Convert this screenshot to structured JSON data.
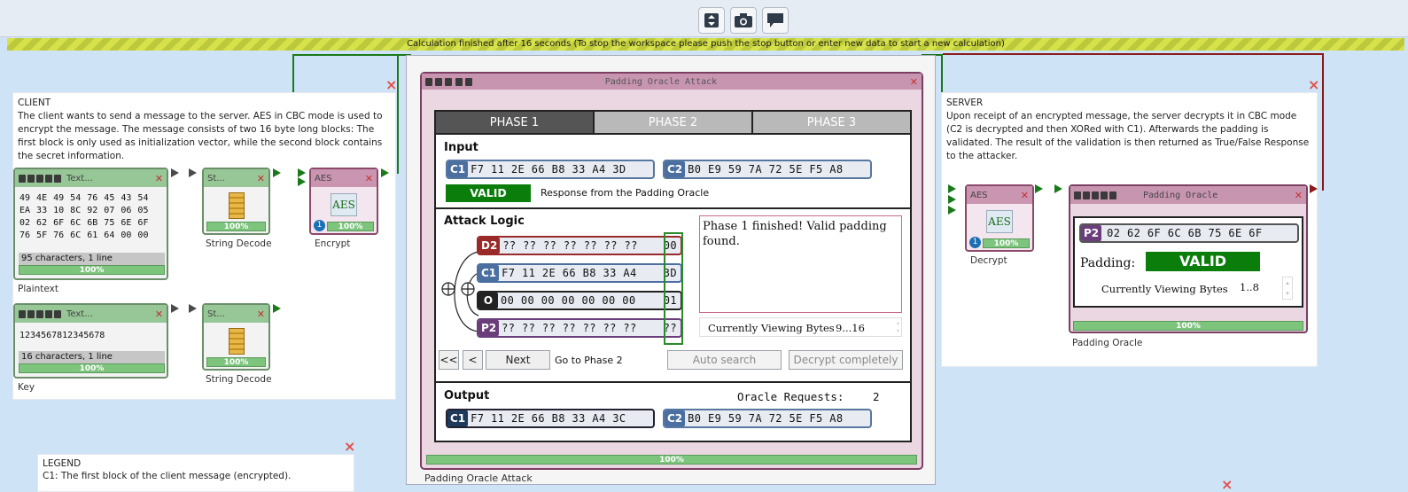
{
  "toolbar": {
    "buttons": [
      {
        "icon": "fit-page-icon"
      },
      {
        "icon": "camera-icon"
      },
      {
        "icon": "speech-bubble-icon"
      }
    ]
  },
  "status": "Calculation finished after 16 seconds (To stop the workspace please push the stop button or enter new data to start a new calculation)",
  "client": {
    "title": "CLIENT",
    "text": "The client wants to send a message to the server. AES in CBC mode is used to encrypt the message. The message consists of two 16 byte long blocks: The first block is only used as initialization vector, while the second block contains the secret information."
  },
  "server": {
    "title": "SERVER",
    "text": "Upon receipt of an encrypted message, the server decrypts it in CBC mode (C2 is decrypted and then XORed with C1). Afterwards the padding is validated. The result of the validation is then returned as True/False Response to the attacker."
  },
  "legend": {
    "title": "LEGEND",
    "line1": "C1: The first block of the client message (encrypted)."
  },
  "plaintext": {
    "header": "Text...",
    "content": "49 4E 49 54 76 45 43 54 EA 33 10 8C 92 07 06 05 02 62 6F 6C 6B 75 6E 6F 76 5F 76 6C 61 64 00 00",
    "info": "95 characters,  1 line",
    "progress": "100%",
    "label": "Plaintext"
  },
  "key": {
    "header": "Text...",
    "content": "1234567812345678",
    "info": "16 characters,  1 line",
    "progress": "100%",
    "label": "Key"
  },
  "decode1": {
    "header": "St...",
    "progress": "100%",
    "label": "String Decode"
  },
  "decode2": {
    "header": "St...",
    "progress": "100%",
    "label": "String Decode"
  },
  "encrypt": {
    "header": "AES",
    "icon_text": "AES",
    "badge": "1",
    "progress": "100%",
    "label": "Encrypt"
  },
  "decrypt": {
    "header": "AES",
    "icon_text": "AES",
    "badge": "1",
    "progress": "100%",
    "label": "Decrypt"
  },
  "poa": {
    "title": "Padding Oracle Attack",
    "tabs": [
      "PHASE 1",
      "PHASE 2",
      "PHASE 3"
    ],
    "input": {
      "heading": "Input",
      "c1_tag": "C1",
      "c1": "F7 11 2E 66 B8 33 A4 3D",
      "c2_tag": "C2",
      "c2": "B0 E9 59 7A 72 5E F5 A8",
      "valid": "VALID",
      "response": "Response from the Padding Oracle"
    },
    "logic": {
      "heading": "Attack Logic",
      "rows": [
        {
          "tag": "D2",
          "bytes": "?? ?? ?? ?? ?? ?? ??",
          "last": "00",
          "color": "#9a2a2a"
        },
        {
          "tag": "C1",
          "bytes": "F7 11 2E 66 B8 33 A4",
          "last": "3D",
          "color": "#4a6fa0"
        },
        {
          "tag": "O",
          "bytes": "00 00 00 00 00 00 00",
          "last": "01",
          "color": "#222222"
        },
        {
          "tag": "P2",
          "bytes": "?? ?? ?? ?? ?? ?? ??",
          "last": "??",
          "color": "#6a3e7a"
        }
      ],
      "message": "Phase 1 finished! Valid padding found.",
      "viewing_label": "Currently Viewing Bytes",
      "viewing_value": "9...16",
      "btn_first": "<<",
      "btn_prev": "<",
      "btn_next": "Next",
      "goto": "Go to Phase 2",
      "btn_auto": "Auto search",
      "btn_decrypt": "Decrypt completely"
    },
    "output": {
      "heading": "Output",
      "requests_label": "Oracle Requests:",
      "requests": "2",
      "c1_tag": "C1",
      "c1": "F7 11 2E 66 B8 33 A4 3C",
      "c2_tag": "C2",
      "c2": "B0 E9 59 7A 72 5E F5 A8"
    },
    "progress": "100%",
    "footer": "Padding Oracle Attack"
  },
  "oracle": {
    "title": "Padding Oracle",
    "p2_tag": "P2",
    "p2": "02 62 6F 6C 6B 75 6E 6F",
    "padding_label": "Padding:",
    "padding_value": "VALID",
    "viewing_label": "Currently Viewing Bytes",
    "viewing_value": "1..8",
    "progress": "100%",
    "label": "Padding Oracle"
  }
}
